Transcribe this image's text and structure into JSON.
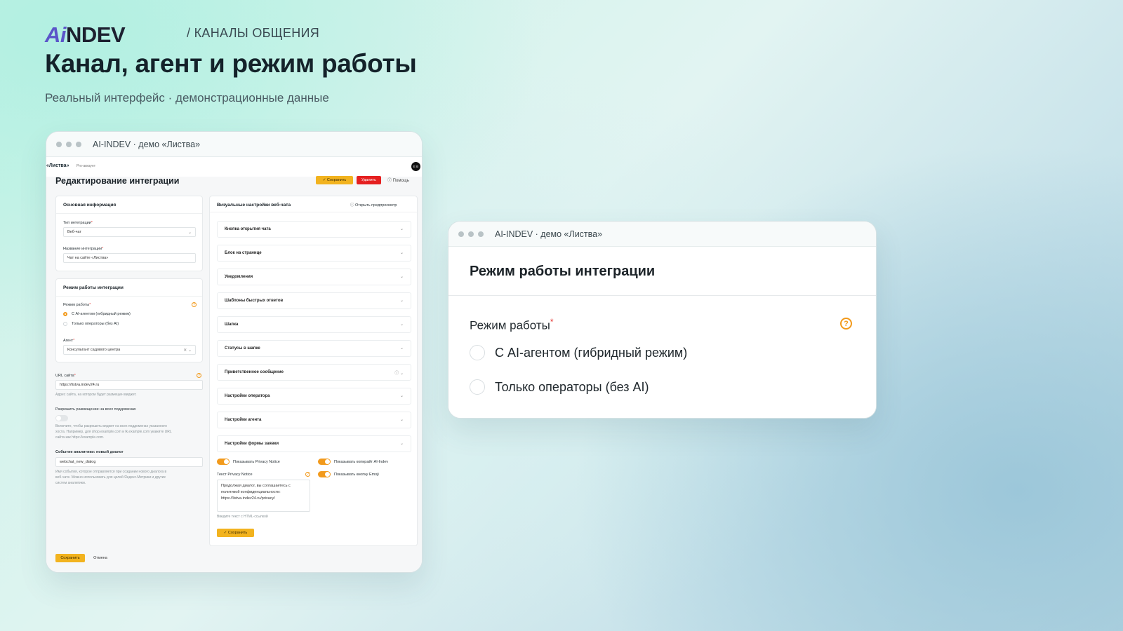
{
  "header": {
    "logo_text": "AiNDEV",
    "logo_accent": "Ai",
    "logo_rest": "NDEV",
    "breadcrumb": "/ КАНАЛЫ ОБЩЕНИЯ",
    "title": "Канал, агент и режим работы",
    "subtitle": "Реальный интерфейс · демонстрационные данные"
  },
  "window_main": {
    "title": "AI-INDEV · демо «Листва»",
    "brand": "«Листва»",
    "brand_sub": "Pro-аккаунт",
    "avatar": "Е В",
    "page_title": "Редактирование интеграции",
    "save_label": "✓ Сохранить",
    "delete_label": "Удалить",
    "help_label": "ⓘ Помощь",
    "basic": {
      "heading": "Основная информация",
      "type_label": "Тип интеграции",
      "type_value": "Веб-чат",
      "name_label": "Название интеграции",
      "name_value": "Чат на сайте «Листва»"
    },
    "mode": {
      "heading": "Режим работы интеграции",
      "mode_label": "Режим работы",
      "option_hybrid": "С AI-агентом (гибридный режим)",
      "option_operators": "Только операторы (без AI)",
      "agent_label": "Агент",
      "agent_value": "Консультант садового центра"
    },
    "url_label": "URL сайта",
    "url_value": "https://listva.indev24.ru",
    "url_hint": "Адрес сайта, на котором будет размещен виджет.",
    "subdomains_label": "Разрешить размещение на всех поддоменах",
    "subdomains_hint_1": "Включите, чтобы разрешить виджет на всех поддоменах указанного",
    "subdomains_hint_2": "хоста. Например, для shop.example.com и lk.example.com укажите URL",
    "subdomains_hint_3": "сайта как https://example.com.",
    "event_label": "Событие аналитики: новый диалог",
    "event_value": "webchat_new_dialog",
    "event_hint_1": "Имя события, которое отправляется при создании нового диалога в",
    "event_hint_2": "веб-чате. Можно использовать для целей Яндекс.Метрики и других",
    "event_hint_3": "систем аналитики.",
    "visual": {
      "heading": "Визуальные настройки веб-чата",
      "preview": "ⓘ Открыть предпросмотр",
      "sections": [
        "Кнопка открытия чата",
        "Блок на странице",
        "Уведомления",
        "Шаблоны быстрых ответов",
        "Шапка",
        "Статусы в шапке",
        "Приветственное сообщение",
        "Настройки оператора",
        "Настройки агента",
        "Настройки формы заявки"
      ],
      "toggle_privacy": "Показывать Privacy Notice",
      "toggle_copyright": "Показывать копирайт AI-Indev",
      "toggle_emoji": "Показывать кнопку Emoji",
      "privacy_label": "Текст Privacy Notice",
      "privacy_text_1": "Продолжая диалог, вы соглашаетесь с",
      "privacy_text_2": "политикой конфиденциальности:",
      "privacy_text_3": "https://listva.indev24.ru/privacy/",
      "privacy_hint": "Введите текст с HTML-ссылкой",
      "save_label": "✓ Сохранить"
    },
    "footer_save": "Сохранить",
    "footer_cancel": "Отмена"
  },
  "window_mode": {
    "title": "AI-INDEV · демо «Листва»",
    "heading": "Режим работы интеграции",
    "field_label": "Режим работы",
    "required_mark": "*",
    "help_glyph": "?",
    "option_hybrid": "С AI-агентом (гибридный режим)",
    "option_operators": "Только операторы (без AI)"
  },
  "colors": {
    "accent": "#f29a1c",
    "save": "#f2b31f",
    "danger": "#e52020",
    "logo_accent": "#5b55c9"
  }
}
